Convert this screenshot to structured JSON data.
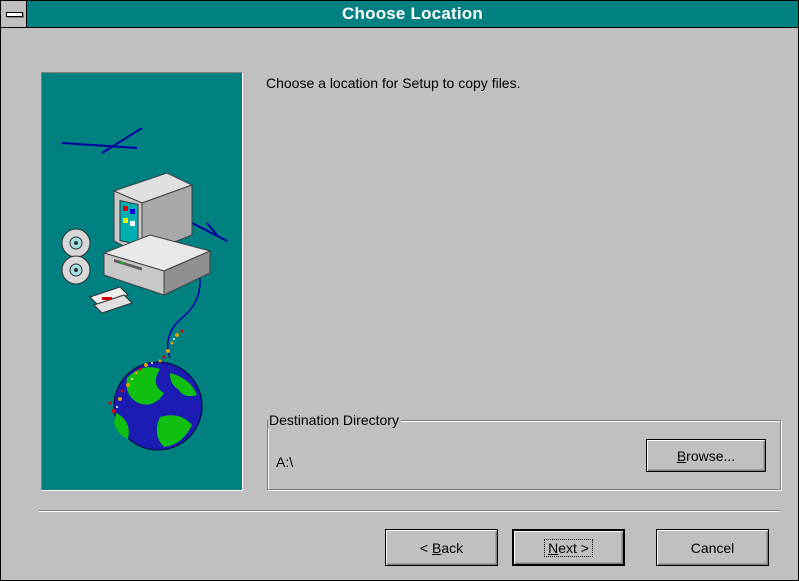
{
  "window": {
    "title": "Choose Location"
  },
  "main": {
    "prompt": "Choose a location for Setup to copy files."
  },
  "destination": {
    "group_label": "Destination Directory",
    "path": "A:\\",
    "browse_label_pre": "B",
    "browse_label_rest": "rowse..."
  },
  "buttons": {
    "back_arrow": "< ",
    "back_key": "B",
    "back_rest": "ack",
    "next_key": "N",
    "next_rest": "ext >",
    "cancel": "Cancel"
  },
  "icons": {
    "system_menu": "system-menu-icon",
    "illustration": "computer-globe-illustration"
  },
  "colors": {
    "title_bar": "#008080",
    "face": "#c0c0c0",
    "art_background": "#008080"
  }
}
